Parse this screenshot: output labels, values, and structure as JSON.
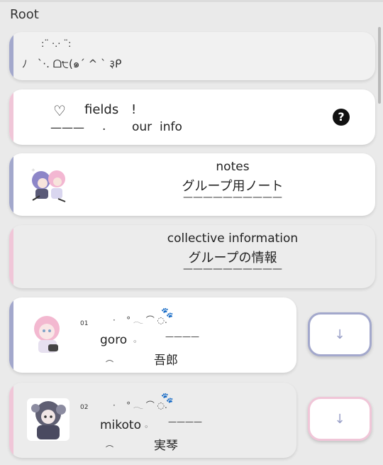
{
  "header": {
    "title": "Root"
  },
  "card1": {
    "line1": ":¨ ·.· ¨:",
    "line2": "ﾉ   `·. ᗝ੮(๑´ ^ ` ३ᑭ"
  },
  "card2": {
    "heart": "♡",
    "fields": "fields",
    "bang": "!",
    "dash": "———",
    "dot": ".",
    "info": "our  info",
    "help": "?"
  },
  "card3": {
    "line1": "notes",
    "line2": "グループ用ノート",
    "line3": "——————————"
  },
  "card4": {
    "line1": "collective  information",
    "line2": "グループの情報",
    "line3": "——————————"
  },
  "members": [
    {
      "num": "01",
      "deco": "·    ° 𓂃 ⌒ ◌.",
      "paw": "🐾",
      "name": "goro",
      "ring": "◦",
      "line": "————",
      "arc": "︵",
      "kanji": "吾郎",
      "arrow": "↓"
    },
    {
      "num": "02",
      "deco": "·    ° 𓂃 ⌒ ◌.",
      "paw": "🐾",
      "name": "mikoto",
      "ring": "◦",
      "line": "————",
      "arc": "︵",
      "kanji": "実琴",
      "arrow": "↓"
    }
  ],
  "colors": {
    "accent_blue": "#a3a8cc",
    "accent_pink": "#f0c6d8",
    "background": "#eaeaea"
  },
  "icons": [
    "help-icon",
    "heart-icon",
    "paw-icon",
    "down-arrow-icon"
  ]
}
